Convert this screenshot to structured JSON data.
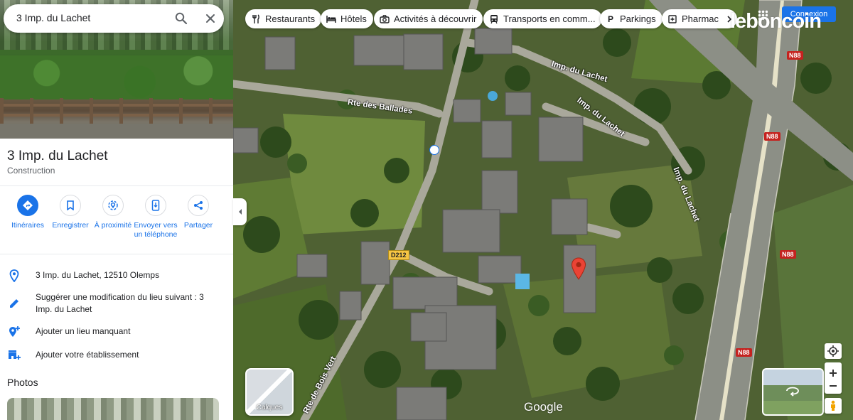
{
  "search": {
    "value": "3 Imp. du Lachet"
  },
  "place": {
    "title": "3 Imp. du Lachet",
    "category": "Construction"
  },
  "actions": [
    {
      "label": "Itinéraires",
      "icon": "directions-icon"
    },
    {
      "label": "Enregistrer",
      "icon": "bookmark-icon"
    },
    {
      "label": "À proximité",
      "icon": "nearby-icon"
    },
    {
      "label": "Envoyer vers un téléphone",
      "icon": "send-to-phone-icon"
    },
    {
      "label": "Partager",
      "icon": "share-icon"
    }
  ],
  "info": [
    {
      "text": "3 Imp. du Lachet, 12510 Olemps",
      "icon": "location-pin-icon"
    },
    {
      "text": "Suggérer une modification du lieu suivant : 3 Imp. du Lachet",
      "icon": "edit-pencil-icon"
    },
    {
      "text": "Ajouter un lieu manquant",
      "icon": "add-place-icon"
    },
    {
      "text": "Ajouter votre établissement",
      "icon": "add-business-icon"
    }
  ],
  "photos_title": "Photos",
  "chips": [
    {
      "label": "Restaurants",
      "icon": "restaurant-icon"
    },
    {
      "label": "Hôtels",
      "icon": "hotel-icon"
    },
    {
      "label": "Activités à découvrir",
      "icon": "camera-icon"
    },
    {
      "label": "Transports en comm...",
      "icon": "transit-icon"
    },
    {
      "label": "Parkings",
      "icon": "parking-icon"
    },
    {
      "label": "Pharmac",
      "icon": "pharmacy-icon"
    }
  ],
  "map": {
    "roads": {
      "ballades": "Rte des Ballades",
      "lachet_top": "Imp. du Lachet",
      "lachet_mid": "Imp. du Lachet",
      "lachet_right": "Imp. du Lachet",
      "bois_vert": "Rte de Bois Vert"
    },
    "route_badges": {
      "n88": "N88",
      "d212": "D212"
    },
    "layers_label": "Calques",
    "watermark": "Google"
  },
  "brand": {
    "logo": "leboncoin",
    "login": "Connexion"
  },
  "colors": {
    "accent": "#1a73e8",
    "marker": "#ea4335"
  }
}
